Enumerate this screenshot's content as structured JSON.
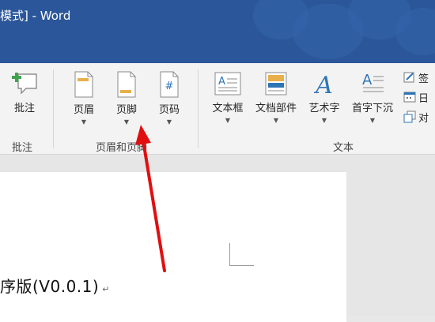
{
  "window": {
    "title": "模式] - Word"
  },
  "ribbon": {
    "groups": [
      {
        "label": "批注"
      },
      {
        "label": "页眉和页脚"
      },
      {
        "label": "文本"
      }
    ],
    "comment_button": {
      "label": "批注"
    },
    "header_button": {
      "label": "页眉"
    },
    "footer_button": {
      "label": "页脚"
    },
    "page_number_button": {
      "label": "页码"
    },
    "textbox_button": {
      "label": "文本框"
    },
    "quick_parts_button": {
      "label": "文档部件"
    },
    "wordart_button": {
      "label": "艺术字"
    },
    "dropcap_button": {
      "label": "首字下沉"
    },
    "side_buttons": [
      {
        "label": "签"
      },
      {
        "label": "日"
      },
      {
        "label": "对"
      }
    ]
  },
  "document": {
    "text": "序版(V0.0.1)",
    "para_mark": "↵"
  },
  "colors": {
    "titlebar": "#2b579a",
    "ribbon": "#f3f3f3",
    "arrow": "#e01010",
    "accent_blue": "#2e75b6"
  }
}
